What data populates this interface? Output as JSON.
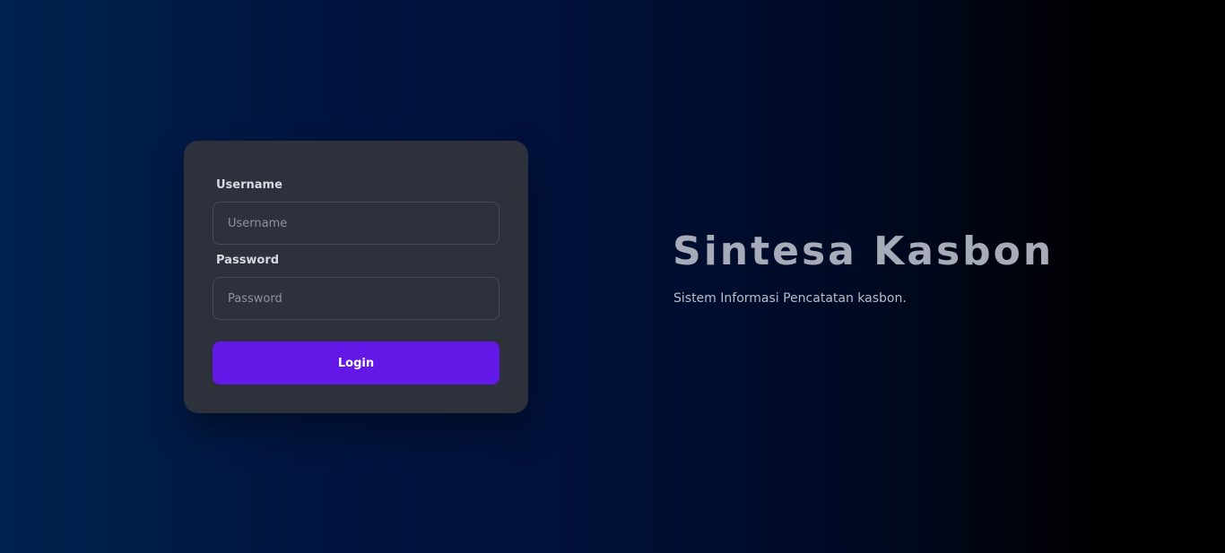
{
  "login": {
    "username_label": "Username",
    "username_placeholder": "Username",
    "username_value": "",
    "password_label": "Password",
    "password_placeholder": "Password",
    "password_value": "",
    "submit_label": "Login"
  },
  "hero": {
    "title": "Sintesa Kasbon",
    "subtitle": "Sistem Informasi Pencatatan kasbon."
  },
  "colors": {
    "card_background": "#2c313c",
    "primary_button": "#6418e8",
    "gradient_start": "#00224f",
    "gradient_end": "#000000"
  }
}
